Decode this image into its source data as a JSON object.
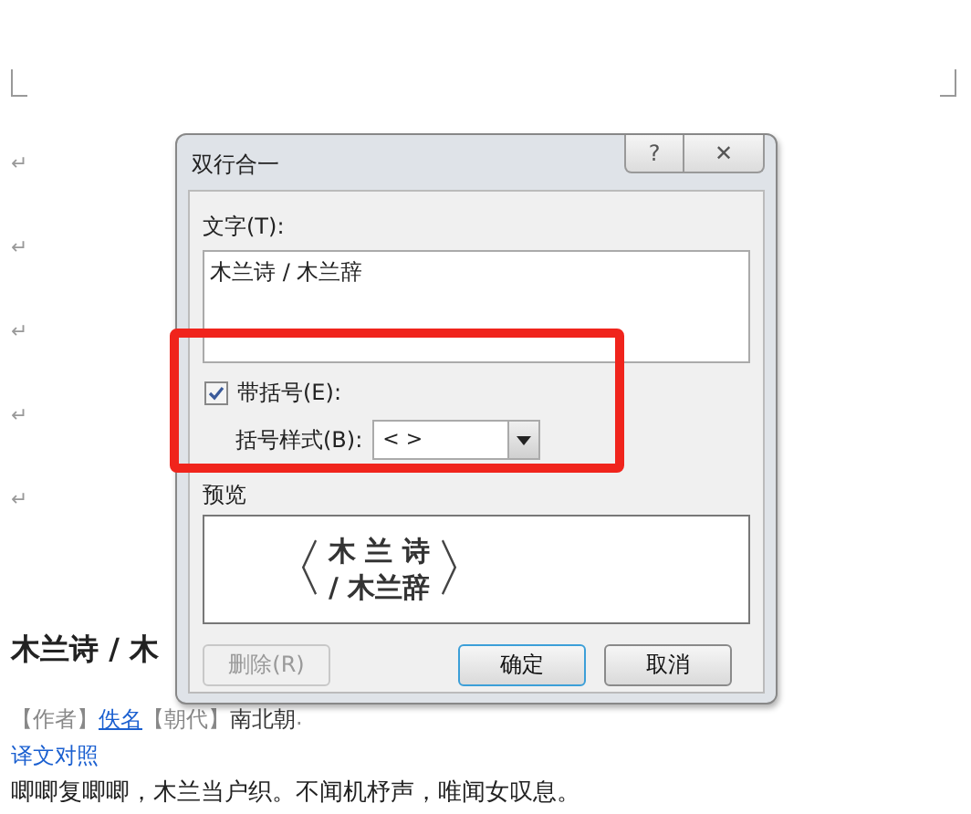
{
  "document": {
    "paragraph_marks": [
      "↵",
      "↵",
      "↵",
      "↵",
      "↵"
    ],
    "heading": "木兰诗 / 木",
    "author_line": [
      {
        "text": "【作者】",
        "kind": "label"
      },
      {
        "text": "佚名",
        "kind": "link"
      },
      {
        "text": "【朝代】",
        "kind": "label"
      },
      {
        "text": "南北朝",
        "kind": "plain"
      },
      {
        "text": ".",
        "kind": "mark"
      }
    ],
    "translation_link": "译文对照",
    "body_line": "唧唧复唧唧，木兰当户织。不闻机杼声，唯闻女叹息。"
  },
  "dialog": {
    "title": "双行合一",
    "help": "?",
    "close": "✕",
    "text_label": "文字(T):",
    "text_value": "木兰诗 / 木兰辞",
    "bracket_checkbox": {
      "label": "带括号(E):",
      "checked": true
    },
    "bracket_style_label": "括号样式(B):",
    "bracket_style_value": "< >",
    "preview_label": "预览",
    "preview": {
      "open": "〈",
      "close": "〉",
      "top": "木 兰 诗",
      "bottom": "/ 木兰辞"
    },
    "buttons": [
      {
        "label": "删除(R)",
        "disabled": true,
        "default": false
      },
      {
        "label": "确定",
        "disabled": false,
        "default": true
      },
      {
        "label": "取消",
        "disabled": false,
        "default": false
      }
    ]
  },
  "highlight": {
    "shown": true
  }
}
